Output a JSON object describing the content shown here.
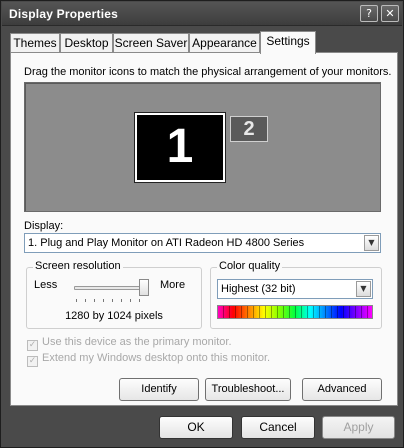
{
  "window": {
    "title": "Display Properties",
    "help_button": "?",
    "close_button": "✕"
  },
  "tabs": [
    {
      "label": "Themes"
    },
    {
      "label": "Desktop"
    },
    {
      "label": "Screen Saver"
    },
    {
      "label": "Appearance"
    },
    {
      "label": "Settings",
      "active": true
    }
  ],
  "settings": {
    "instruction": "Drag the monitor icons to match the physical arrangement of your monitors.",
    "monitors": [
      {
        "number": "1",
        "selected": true
      },
      {
        "number": "2",
        "selected": false
      }
    ],
    "display_label": "Display:",
    "display_value": "1. Plug and Play Monitor on ATI Radeon HD 4800 Series",
    "screen_resolution": {
      "title": "Screen resolution",
      "less_label": "Less",
      "more_label": "More",
      "value_text": "1280 by 1024 pixels",
      "slider_level_pct": 100
    },
    "color_quality": {
      "title": "Color quality",
      "value": "Highest (32 bit)"
    },
    "checkboxes": [
      {
        "label": "Use this device as the primary monitor.",
        "checked": true,
        "disabled": true
      },
      {
        "label": "Extend my Windows desktop onto this monitor.",
        "checked": true,
        "disabled": true
      }
    ],
    "buttons": {
      "identify": "Identify",
      "troubleshoot": "Troubleshoot...",
      "advanced": "Advanced"
    }
  },
  "footer": {
    "ok": "OK",
    "cancel": "Cancel",
    "apply": "Apply"
  },
  "icons": {
    "dropdown": "chevron-down-icon",
    "check": "check-icon"
  }
}
